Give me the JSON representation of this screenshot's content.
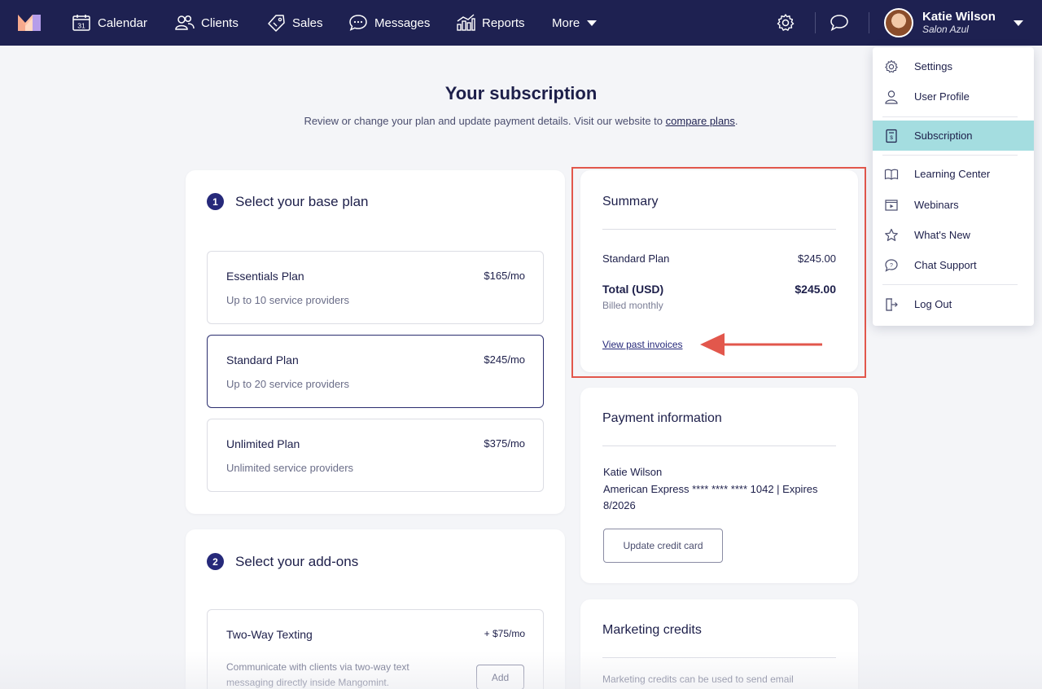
{
  "nav": {
    "items": [
      {
        "label": "Calendar",
        "icon": "calendar-icon",
        "badge": "31"
      },
      {
        "label": "Clients",
        "icon": "clients-icon"
      },
      {
        "label": "Sales",
        "icon": "tag-icon"
      },
      {
        "label": "Messages",
        "icon": "chat-bubble-icon"
      },
      {
        "label": "Reports",
        "icon": "bar-chart-icon"
      },
      {
        "label": "More",
        "icon": "caret-down-icon"
      }
    ],
    "user": {
      "name": "Katie Wilson",
      "business": "Salon Azul"
    }
  },
  "header": {
    "title": "Your subscription",
    "subtitle_prefix": "Review or change your plan and update payment details. Visit our website to ",
    "subtitle_link": "compare plans",
    "subtitle_suffix": "."
  },
  "base_plan": {
    "step": "1",
    "title": "Select your base plan",
    "plans": [
      {
        "name": "Essentials Plan",
        "price": "$165/mo",
        "desc": "Up to 10 service providers",
        "selected": false
      },
      {
        "name": "Standard Plan",
        "price": "$245/mo",
        "desc": "Up to 20 service providers",
        "selected": true
      },
      {
        "name": "Unlimited Plan",
        "price": "$375/mo",
        "desc": "Unlimited service providers",
        "selected": false
      }
    ]
  },
  "addons": {
    "step": "2",
    "title": "Select your add-ons",
    "items": [
      {
        "name": "Two-Way Texting",
        "price": "+ $75/mo",
        "desc": "Communicate with clients via two-way text messaging directly inside Mangomint.",
        "button": "Add"
      }
    ]
  },
  "summary": {
    "title": "Summary",
    "line_label": "Standard Plan",
    "line_value": "$245.00",
    "total_label": "Total (USD)",
    "total_value": "$245.00",
    "billing": "Billed monthly",
    "invoices_link": "View past invoices"
  },
  "payment": {
    "title": "Payment information",
    "name": "Katie Wilson",
    "card_line1": "American Express **** **** **** 1042 | Expires",
    "card_line2": "8/2026",
    "button": "Update credit card"
  },
  "marketing": {
    "title": "Marketing credits",
    "desc": "Marketing credits can be used to send email"
  },
  "user_menu": {
    "items": [
      {
        "label": "Settings",
        "icon": "gear-icon"
      },
      {
        "label": "User Profile",
        "icon": "user-icon"
      },
      {
        "label": "Subscription",
        "icon": "receipt-icon",
        "active": true
      },
      {
        "label": "Learning Center",
        "icon": "book-icon"
      },
      {
        "label": "Webinars",
        "icon": "video-icon"
      },
      {
        "label": "What's New",
        "icon": "star-icon"
      },
      {
        "label": "Chat Support",
        "icon": "support-chat-icon"
      },
      {
        "label": "Log Out",
        "icon": "logout-icon"
      }
    ]
  },
  "colors": {
    "nav_bg": "#1e2151",
    "accent": "#26297a",
    "menu_active": "#a4dde0",
    "annotation": "#e2574c",
    "page_bg": "#f4f5f8"
  }
}
